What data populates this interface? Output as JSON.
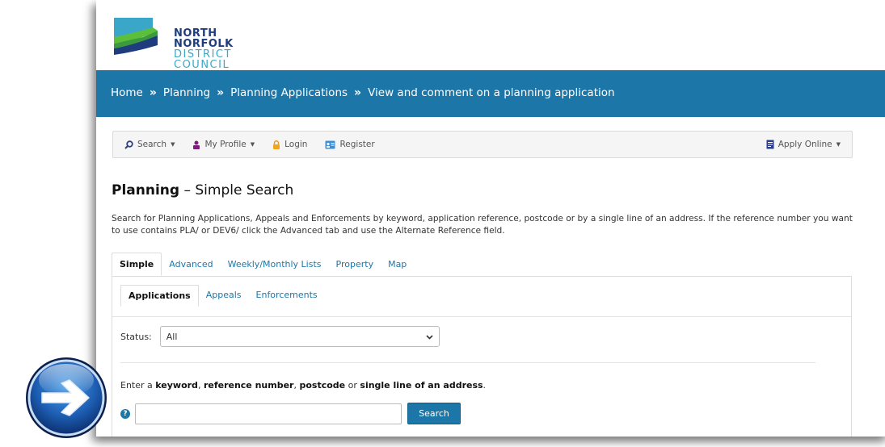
{
  "logo": {
    "line1": "NORTH",
    "line2": "NORFOLK",
    "line3": "DISTRICT",
    "line4": "COUNCIL",
    "colors": {
      "navy": "#1f3c7c",
      "teal": "#3aa7c9",
      "green": "#3a9a3c"
    }
  },
  "breadcrumb": {
    "items": [
      "Home",
      "Planning",
      "Planning Applications",
      "View and comment on a planning application"
    ],
    "separator": "»"
  },
  "toolbar": {
    "search_label": "Search",
    "profile_label": "My Profile",
    "login_label": "Login",
    "register_label": "Register",
    "apply_label": "Apply Online"
  },
  "page": {
    "title_bold": "Planning",
    "title_rest": " – Simple Search",
    "intro": "Search for Planning Applications, Appeals and Enforcements by keyword, application reference, postcode or by a single line of an address. If the reference number you want to use contains PLA/ or DEV6/ click the Advanced tab and use the Alternate Reference field."
  },
  "tabs": [
    "Simple",
    "Advanced",
    "Weekly/Monthly Lists",
    "Property",
    "Map"
  ],
  "subtabs": [
    "Applications",
    "Appeals",
    "Enforcements"
  ],
  "status": {
    "label": "Status:",
    "selected": "All"
  },
  "hint": {
    "prefix": "Enter a ",
    "k1": "keyword",
    "s1": ", ",
    "k2": "reference number",
    "s2": ", ",
    "k3": "postcode",
    "s3": " or ",
    "k4": "single line of an address",
    "suffix": "."
  },
  "search": {
    "value": "",
    "button_label": "Search",
    "help_glyph": "?"
  },
  "colors": {
    "brand_blue": "#1c77a8",
    "arrow_blue": "#1e5fb4"
  }
}
